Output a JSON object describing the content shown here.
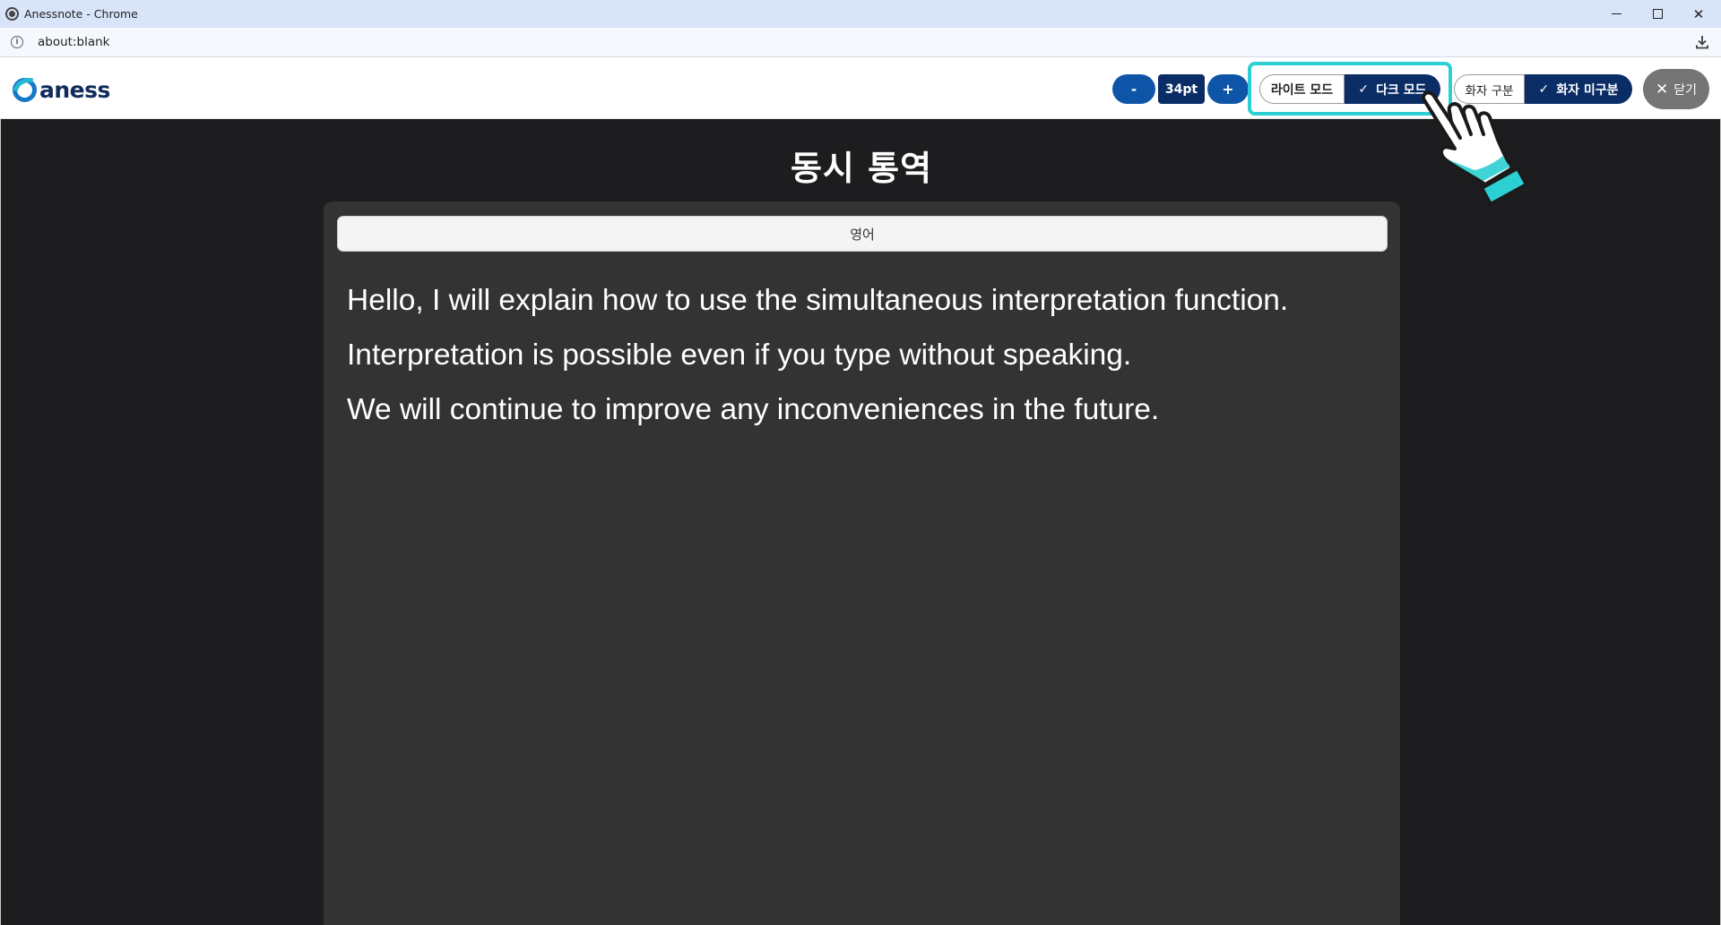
{
  "window": {
    "title": "Anessnote - Chrome"
  },
  "browser": {
    "url": "about:blank"
  },
  "header": {
    "logo_text": "aness",
    "font_decrease_label": "-",
    "font_size": "34pt",
    "font_increase_label": "+",
    "light_mode_label": "라이트 모드",
    "dark_mode_label": "다크 모드",
    "speaker_separate_label": "화자 구분",
    "speaker_no_separate_label": "화자 미구분",
    "close_label": "닫기",
    "selected_theme": "dark",
    "selected_speaker_mode": "no-separate"
  },
  "main": {
    "title": "동시 통역",
    "language": "영어",
    "lines": [
      "Hello, I will explain how to use the simultaneous interpretation function.",
      "Interpretation is possible even if you type without speaking.",
      "We will continue to improve any inconveniences in the future."
    ]
  },
  "colors": {
    "accent": "#0b2d66",
    "button_blue": "#0e55a8",
    "highlight": "#2ccfd3",
    "background_dark": "#1d1d20",
    "panel": "#333333"
  },
  "icons": {
    "window": "chrome-app-icon",
    "info": "info-icon",
    "download": "download-icon",
    "check": "check-icon",
    "close": "close-icon",
    "pointer": "hand-pointer-icon"
  }
}
